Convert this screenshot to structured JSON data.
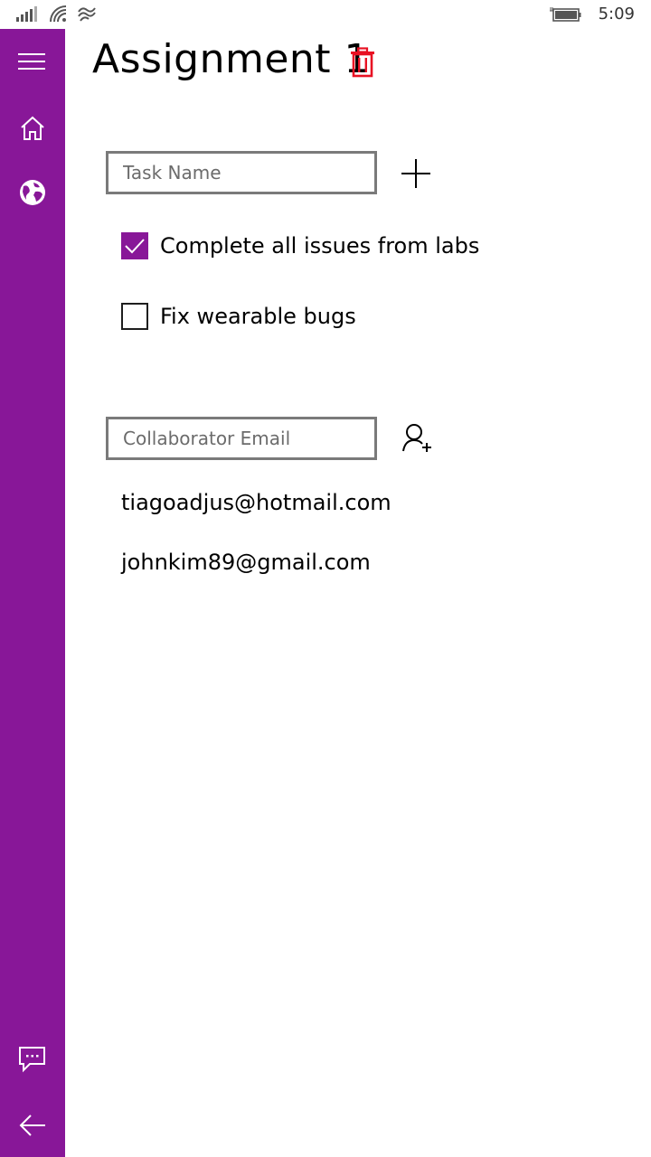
{
  "status_bar": {
    "time": "5:09"
  },
  "page": {
    "title": "Assignment 1"
  },
  "tasks": {
    "input_placeholder": "Task Name",
    "items": [
      {
        "label": "Complete all issues from labs",
        "checked": true
      },
      {
        "label": "Fix wearable bugs",
        "checked": false
      }
    ]
  },
  "collaborators": {
    "input_placeholder": "Collaborator Email",
    "items": [
      {
        "email": "tiagoadjus@hotmail.com"
      },
      {
        "email": "johnkim89@gmail.com"
      }
    ]
  },
  "colors": {
    "accent": "#881798",
    "delete": "#e81123"
  },
  "icons": [
    "hamburger-icon",
    "home-icon",
    "globe-icon",
    "feedback-icon",
    "back-arrow-icon",
    "trash-icon",
    "plus-icon",
    "add-person-icon",
    "checkmark-icon"
  ]
}
